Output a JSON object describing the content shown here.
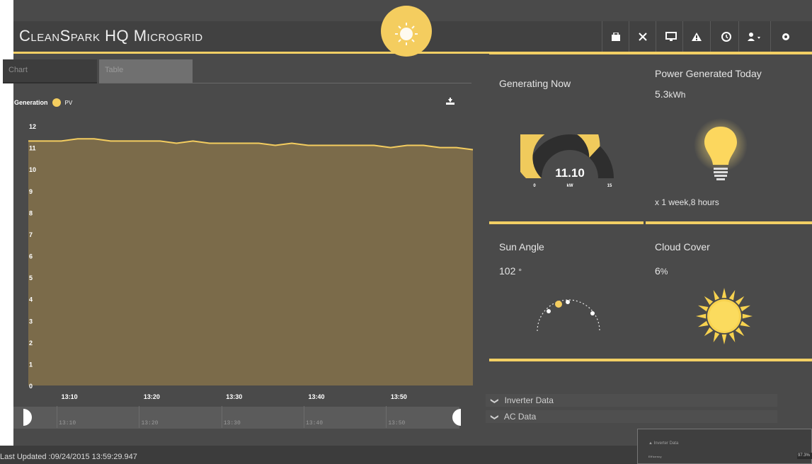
{
  "header": {
    "title": "CleanSpark HQ Microgrid",
    "icons": [
      "briefcase-icon",
      "expand-icon",
      "monitor-icon",
      "alert-icon",
      "history-icon",
      "user-icon",
      "gear-icon"
    ]
  },
  "tabs": {
    "chart": "Chart",
    "table": "Table"
  },
  "chart_data": {
    "type": "area",
    "title": "Generation",
    "series": [
      {
        "name": "PV",
        "color": "#f4cd5f",
        "x": [
          "13:05",
          "13:07",
          "13:09",
          "13:11",
          "13:13",
          "13:15",
          "13:17",
          "13:19",
          "13:21",
          "13:23",
          "13:25",
          "13:27",
          "13:29",
          "13:31",
          "13:33",
          "13:35",
          "13:37",
          "13:39",
          "13:41",
          "13:43",
          "13:45",
          "13:47",
          "13:49",
          "13:51",
          "13:53",
          "13:55",
          "13:57",
          "13:59"
        ],
        "values": [
          11.3,
          11.3,
          11.3,
          11.4,
          11.4,
          11.3,
          11.3,
          11.3,
          11.3,
          11.2,
          11.3,
          11.2,
          11.2,
          11.2,
          11.2,
          11.1,
          11.2,
          11.1,
          11.1,
          11.1,
          11.1,
          11.1,
          11.0,
          11.1,
          11.1,
          11.0,
          11.0,
          10.9
        ]
      }
    ],
    "yticks": [
      0,
      1,
      2,
      3,
      4,
      5,
      6,
      7,
      8,
      9,
      10,
      11,
      12
    ],
    "ylim": [
      0,
      12
    ],
    "xticks": [
      "13:10",
      "13:20",
      "13:30",
      "13:40",
      "13:50"
    ],
    "navigator_ticks": [
      "13:10",
      "13:20",
      "13:30",
      "13:40",
      "13:50"
    ]
  },
  "generating_now": {
    "title": "Generating Now",
    "value": "11.10",
    "unit": "kW",
    "min": "0",
    "max": "15",
    "fraction": 0.74
  },
  "power_today": {
    "title": "Power Generated Today",
    "value": "5.3",
    "unit": "kWh",
    "equivalent": "x 1 week,8 hours"
  },
  "sun_angle": {
    "title": "Sun Angle",
    "value": "102",
    "unit": "°"
  },
  "cloud_cover": {
    "title": "Cloud Cover",
    "value": "6",
    "unit": "%"
  },
  "sections": {
    "inverter": "Inverter Data",
    "ac": "AC Data"
  },
  "status": {
    "last_updated": "Last Updated :09/24/2015 13:59:29.947"
  },
  "popup": {
    "title": "Inverter Data",
    "label": "Efficency",
    "value": "97.3%"
  },
  "colors": {
    "accent": "#f2cf64",
    "area_fill": "#7b6b4a",
    "background": "#4a4a4a",
    "header": "#414141"
  }
}
